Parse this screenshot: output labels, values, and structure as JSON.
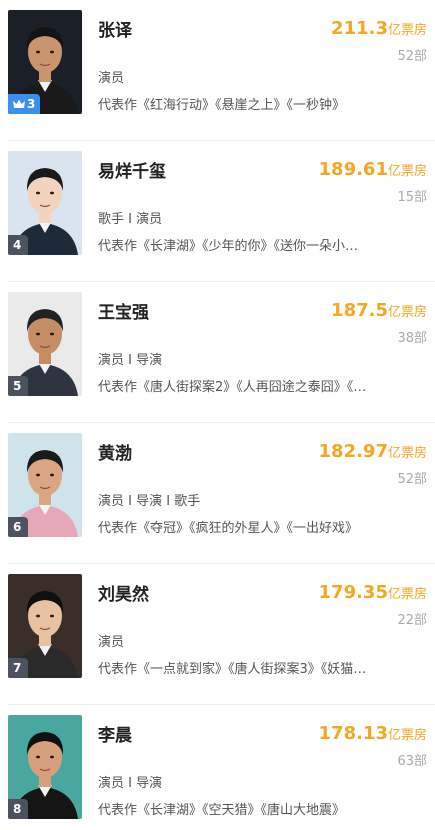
{
  "actors": [
    {
      "rank": "3",
      "crown": true,
      "badge_color": "#3b8ff0",
      "name": "张译",
      "box_num": "211.3",
      "box_unit": "亿票房",
      "works": "52部",
      "roles": "演员",
      "reps": "代表作《红海行动》《悬崖之上》《一秒钟》",
      "bg": "#1b2028",
      "face": "#c9956e",
      "hair": "#141414",
      "cloth": "#1a1a1a"
    },
    {
      "rank": "4",
      "crown": false,
      "badge_color": "#4d5260",
      "name": "易烊千玺",
      "box_num": "189.61",
      "box_unit": "亿票房",
      "works": "15部",
      "roles": "歌手 I 演员",
      "reps": "代表作《长津湖》《少年的你》《送你一朵小…",
      "bg": "#d9e4ee",
      "face": "#f2d3be",
      "hair": "#1a1a1a",
      "cloth": "#1c2a3a"
    },
    {
      "rank": "5",
      "crown": false,
      "badge_color": "#4d5260",
      "name": "王宝强",
      "box_num": "187.5",
      "box_unit": "亿票房",
      "works": "38部",
      "roles": "演员 I 导演",
      "reps": "代表作《唐人街探案2》《人再囧途之泰囧》《…",
      "bg": "#eaeaea",
      "face": "#c48d66",
      "hair": "#222222",
      "cloth": "#2e3440"
    },
    {
      "rank": "6",
      "crown": false,
      "badge_color": "#4d5260",
      "name": "黄渤",
      "box_num": "182.97",
      "box_unit": "亿票房",
      "works": "52部",
      "roles": "演员 I 导演 I 歌手",
      "reps": "代表作《夺冠》《疯狂的外星人》《一出好戏》",
      "bg": "#cfe3ea",
      "face": "#d9a582",
      "hair": "#1a1a1a",
      "cloth": "#e6a8b8"
    },
    {
      "rank": "7",
      "crown": false,
      "badge_color": "#4d5260",
      "name": "刘昊然",
      "box_num": "179.35",
      "box_unit": "亿票房",
      "works": "22部",
      "roles": "演员",
      "reps": "代表作《一点就到家》《唐人街探案3》《妖猫…",
      "bg": "#3a2f28",
      "face": "#e8c0a2",
      "hair": "#0f0f0f",
      "cloth": "#2a2a2a"
    },
    {
      "rank": "8",
      "crown": false,
      "badge_color": "#4d5260",
      "name": "李晨",
      "box_num": "178.13",
      "box_unit": "亿票房",
      "works": "63部",
      "roles": "演员 I 导演",
      "reps": "代表作《长津湖》《空天猎》《唐山大地震》",
      "bg": "#4aa7a0",
      "face": "#d7a07c",
      "hair": "#111111",
      "cloth": "#151515"
    }
  ]
}
